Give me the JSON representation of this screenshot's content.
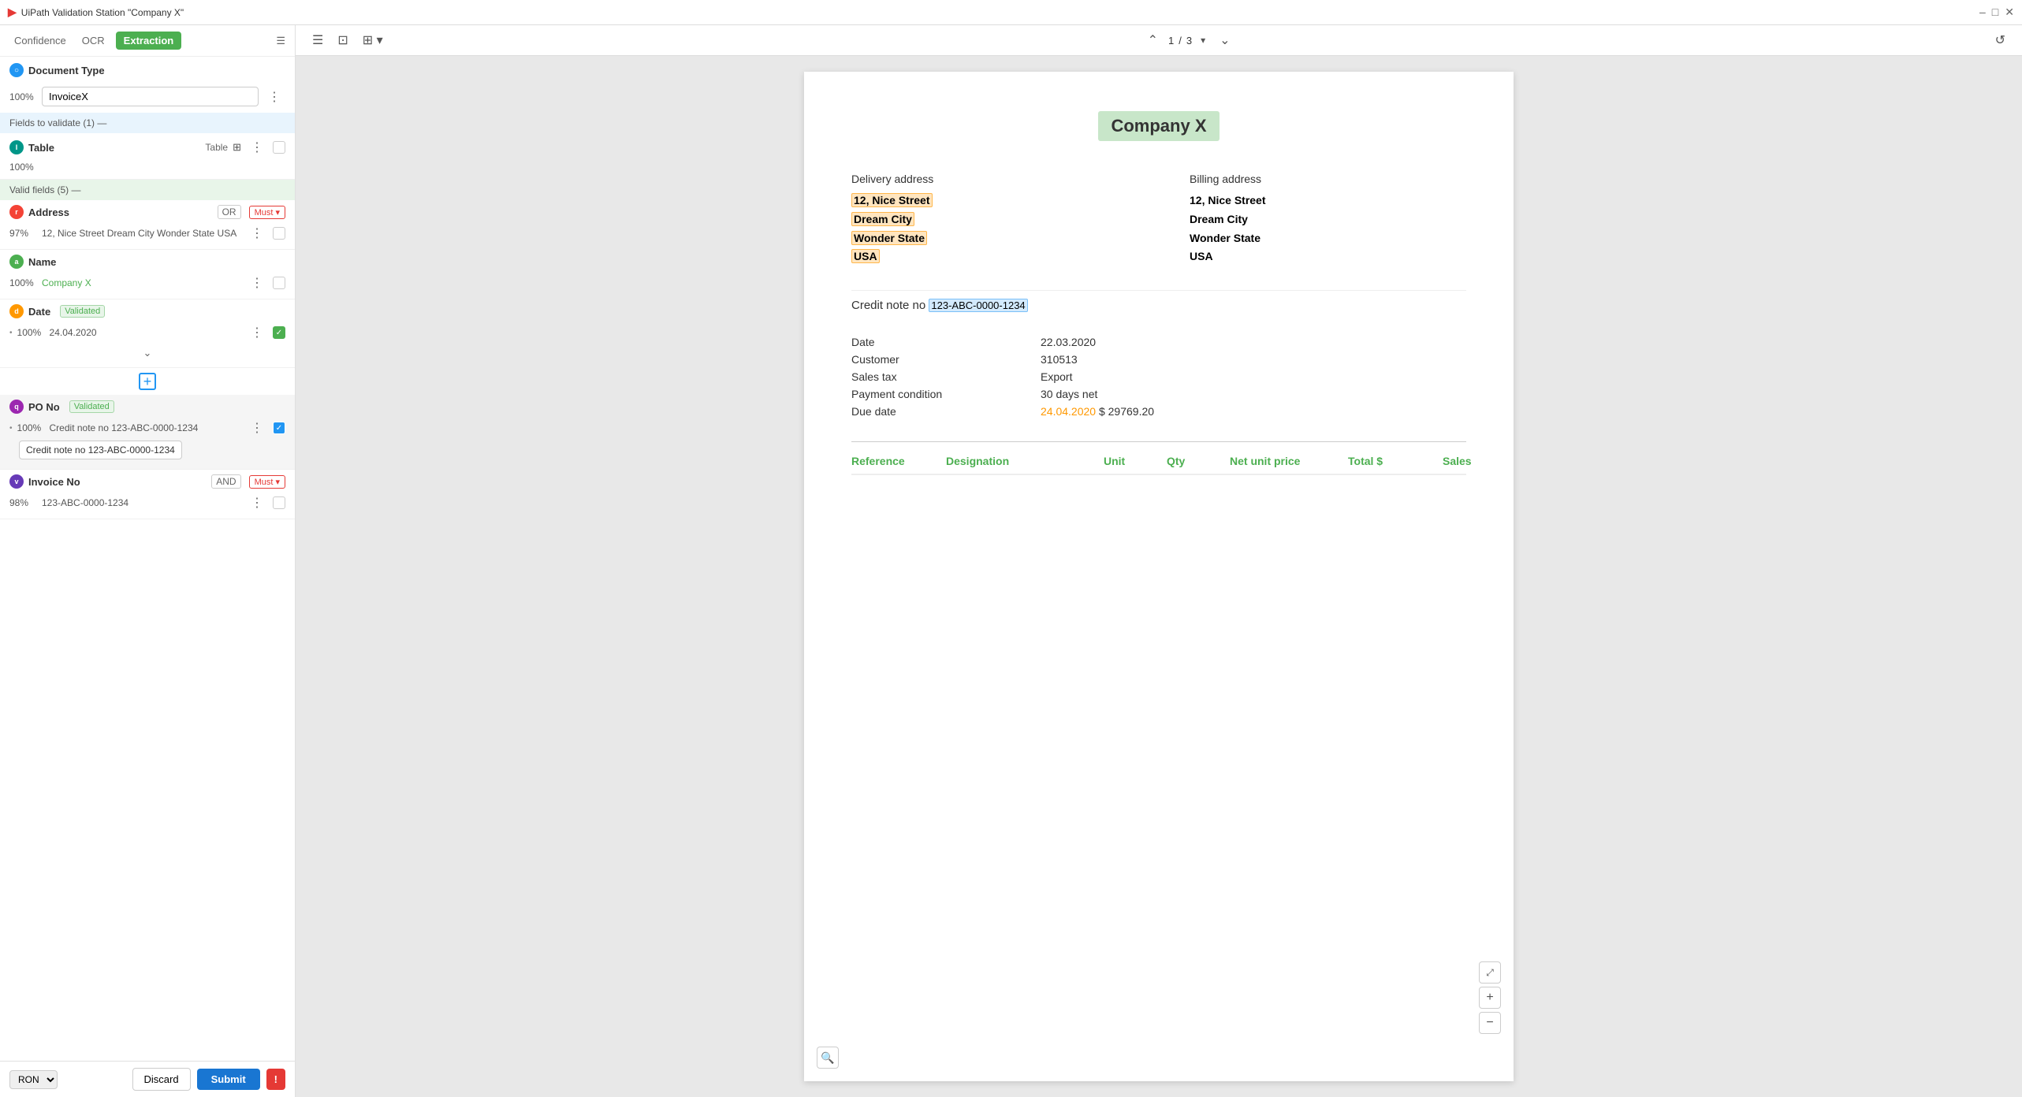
{
  "titleBar": {
    "title": "UiPath Validation Station \"Company X\"",
    "controls": [
      "–",
      "□",
      "✕"
    ]
  },
  "leftPanel": {
    "tabs": {
      "confidence": "Confidence",
      "ocr": "OCR",
      "extraction": "Extraction"
    },
    "activeTab": "Extraction",
    "documentType": {
      "label": "Document Type",
      "confidence": "100%",
      "selectedValue": "InvoiceX"
    },
    "fieldsToValidate": {
      "label": "Fields to validate (1) —"
    },
    "tableField": {
      "name": "Table",
      "confidence": "100%",
      "label": "Table"
    },
    "validFields": {
      "label": "Valid fields (5) —"
    },
    "fields": [
      {
        "id": "address",
        "name": "Address",
        "circle": "r",
        "circleColor": "circle-red",
        "tags": [
          "OR",
          "Must"
        ],
        "confidence": "97%",
        "value": "12, Nice Street Dream City Wonder State USA",
        "checked": false
      },
      {
        "id": "name",
        "name": "Name",
        "circle": "a",
        "circleColor": "circle-green",
        "tags": [],
        "confidence": "100%",
        "value": "Company X",
        "checked": false
      },
      {
        "id": "date",
        "name": "Date",
        "circle": "d",
        "circleColor": "circle-orange",
        "tags": [],
        "validated": "Validated",
        "subfields": [
          {
            "confidence": "100%",
            "value": "24.04.2020",
            "checked": true
          }
        ]
      },
      {
        "id": "po_no",
        "name": "PO No",
        "circle": "q",
        "circleColor": "circle-purple",
        "tags": [],
        "validated": "Validated",
        "subfields": [
          {
            "confidence": "100%",
            "value": "Credit note no 123-ABC-0000-1234",
            "checked": true
          }
        ],
        "tooltip": "Credit note no 123-ABC-0000-1234"
      },
      {
        "id": "invoice_no",
        "name": "Invoice No",
        "circle": "v",
        "circleColor": "circle-violet",
        "tags": [
          "AND",
          "Must"
        ],
        "confidence": "98%",
        "value": "123-ABC-0000-1234",
        "checked": false
      }
    ],
    "bottomBar": {
      "language": "RON",
      "discard": "Discard",
      "submit": "Submit"
    }
  },
  "docToolbar": {
    "pageNum": "1",
    "totalPages": "3"
  },
  "document": {
    "companyName": "Company X",
    "deliveryAddressLabel": "Delivery address",
    "billingAddressLabel": "Billing address",
    "deliveryAddress": {
      "line1": "12, Nice Street",
      "line2": "Dream City",
      "line3": "Wonder State",
      "line4": "USA"
    },
    "billingAddress": {
      "line1": "12, Nice Street",
      "line2": "Dream City",
      "line3": "Wonder State",
      "line4": "USA"
    },
    "creditNoteTitle": "Credit note no",
    "creditNoteNumber": "123-ABC-0000-1234",
    "details": [
      {
        "label": "Date",
        "value": "22.03.2020",
        "highlight": false
      },
      {
        "label": "Customer",
        "value": "310513",
        "highlight": false
      },
      {
        "label": "Sales tax",
        "value": "Export",
        "highlight": false
      },
      {
        "label": "Payment condition",
        "value": "30 days net",
        "highlight": false
      },
      {
        "label": "Due date",
        "value": "24.04.2020",
        "highlight": true,
        "extraValue": "$ 29769.20"
      }
    ],
    "tableHeaders": [
      "Reference",
      "Designation",
      "Unit",
      "Qty",
      "Net unit price",
      "Total $",
      "Sales"
    ]
  }
}
